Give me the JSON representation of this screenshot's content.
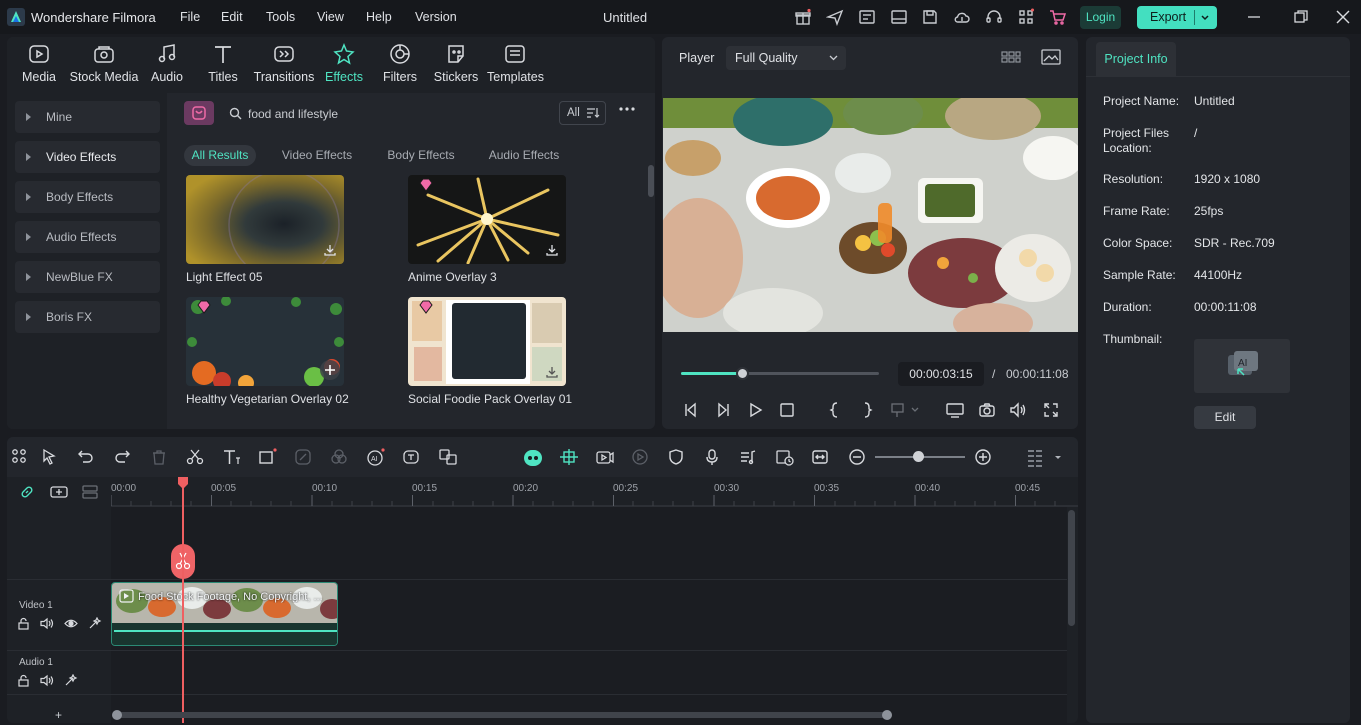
{
  "titlebar": {
    "app_name": "Wondershare Filmora",
    "menu": [
      "File",
      "Edit",
      "Tools",
      "View",
      "Help",
      "Version"
    ],
    "document_title": "Untitled",
    "login_label": "Login",
    "export_label": "Export"
  },
  "library": {
    "tabs": [
      {
        "label": "Media",
        "icon": "media-icon"
      },
      {
        "label": "Stock Media",
        "icon": "stock-media-icon"
      },
      {
        "label": "Audio",
        "icon": "audio-icon"
      },
      {
        "label": "Titles",
        "icon": "titles-icon"
      },
      {
        "label": "Transitions",
        "icon": "transitions-icon"
      },
      {
        "label": "Effects",
        "icon": "effects-icon",
        "active": true
      },
      {
        "label": "Filters",
        "icon": "filters-icon"
      },
      {
        "label": "Stickers",
        "icon": "stickers-icon"
      },
      {
        "label": "Templates",
        "icon": "templates-icon"
      }
    ],
    "sidebar": [
      "Mine",
      "Video Effects",
      "Body Effects",
      "Audio Effects",
      "NewBlue FX",
      "Boris FX"
    ],
    "search": {
      "value": "food and lifestyle",
      "placeholder": ""
    },
    "filter_label": "All",
    "chips": [
      "All Results",
      "Video Effects",
      "Body Effects",
      "Audio Effects"
    ],
    "items": [
      {
        "name": "Light Effect 05",
        "premium": false,
        "action": "download"
      },
      {
        "name": "Anime Overlay 3",
        "premium": true,
        "action": "download"
      },
      {
        "name": "Healthy Vegetarian Overlay 02",
        "premium": true,
        "action": "add"
      },
      {
        "name": "Social Foodie Pack Overlay 01",
        "premium": true,
        "action": "download"
      }
    ]
  },
  "player": {
    "label": "Player",
    "quality": "Full Quality",
    "current_time": "00:00:03:15",
    "separator": "/",
    "total_time": "00:00:11:08",
    "progress": 0.31
  },
  "project_info": {
    "tab_label": "Project Info",
    "fields": [
      {
        "label": "Project Name:",
        "value": "Untitled"
      },
      {
        "label": "Project Files Location:",
        "value": "/"
      },
      {
        "label": "Resolution:",
        "value": "1920 x 1080"
      },
      {
        "label": "Frame Rate:",
        "value": "25fps"
      },
      {
        "label": "Color Space:",
        "value": "SDR - Rec.709"
      },
      {
        "label": "Sample Rate:",
        "value": "44100Hz"
      },
      {
        "label": "Duration:",
        "value": "00:00:11:08"
      },
      {
        "label": "Thumbnail:",
        "value": ""
      }
    ],
    "edit_label": "Edit"
  },
  "timeline": {
    "ruler": [
      "00:00",
      "00:05",
      "00:10",
      "00:15",
      "00:20",
      "00:25",
      "00:30",
      "00:35",
      "00:40",
      "00:45"
    ],
    "tracks": [
      "Video 1",
      "Audio 1"
    ],
    "clip_title": "Food Stock Footage, No Copyright, ...",
    "add_track_label": "+"
  },
  "colors": {
    "accent": "#4fe4c2",
    "playhead": "#ef5f61",
    "premium": "#f06aa7"
  }
}
